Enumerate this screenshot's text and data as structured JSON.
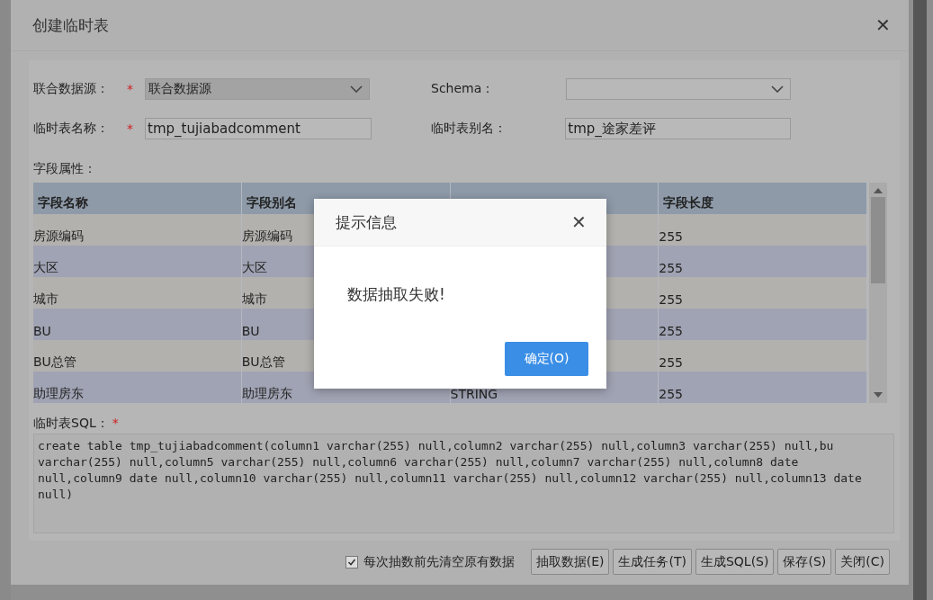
{
  "dialog": {
    "title": "创建临时表",
    "close": "✕"
  },
  "form": {
    "fields": [
      {
        "label": "联合数据源：",
        "marker": "*",
        "kind": "select",
        "value": "联合数据源"
      },
      {
        "label": "Schema：",
        "kind": "select"
      },
      {
        "label": "临时表名称：",
        "marker": "*",
        "kind": "text",
        "value": "tmp_tujiabadcomment"
      },
      {
        "label": "临时表别名：",
        "kind": "text",
        "value": "tmp_途家差评"
      }
    ]
  },
  "table": {
    "title": "字段属性：",
    "columns": [
      "字段名称",
      "字段别名",
      "",
      "字段长度"
    ],
    "rows": [
      [
        "房源编码",
        "房源编码",
        "",
        "255"
      ],
      [
        "大区",
        "大区",
        "",
        "255"
      ],
      [
        "城市",
        "城市",
        "",
        "255"
      ],
      [
        "BU",
        "BU",
        "",
        "255"
      ],
      [
        "BU总管",
        "BU总管",
        "",
        "255"
      ],
      [
        "助理房东",
        "助理房东",
        "STRING",
        "255"
      ]
    ]
  },
  "sql": {
    "label": "临时表SQL：",
    "marker": "*",
    "value": "create table tmp_tujiabadcomment(column1 varchar(255) null,column2 varchar(255) null,column3 varchar(255) null,bu varchar(255) null,column5 varchar(255) null,column6 varchar(255) null,column7 varchar(255) null,column8 date null,column9 date null,column10 varchar(255) null,column11 varchar(255) null,column12 varchar(255) null,column13 date null)"
  },
  "footer": {
    "checkbox": {
      "label": "每次抽数前先清空原有数据",
      "checked": true
    },
    "buttons": [
      "抽取数据(E)",
      "生成任务(T)",
      "生成SQL(S)",
      "保存(S)",
      "关闭(C)"
    ]
  },
  "alert": {
    "title": "提示信息",
    "close": "✕",
    "message": "数据抽取失败!",
    "button": "确定(O)"
  }
}
